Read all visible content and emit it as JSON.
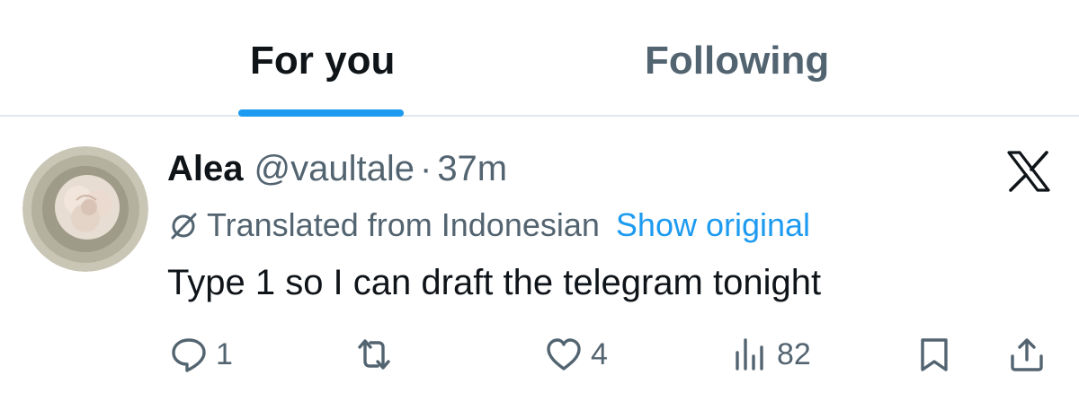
{
  "tabs": [
    {
      "label": "For you",
      "active": true
    },
    {
      "label": "Following",
      "active": false
    }
  ],
  "tweet": {
    "author_name": "Alea",
    "handle": "@vaultale",
    "separator": "·",
    "time": "37m",
    "translation_note": "Translated from Indonesian",
    "show_original_label": "Show original",
    "text": "Type 1 so I can draft the telegram tonight",
    "avatar_icon": "rose-teacup-avatar",
    "more_icon": "x-logo-icon"
  },
  "actions": {
    "reply_count": "1",
    "retweet_count": "",
    "like_count": "4",
    "views_count": "82"
  },
  "colors": {
    "accent": "#1d9bf0",
    "text_primary": "#0f1419",
    "text_secondary": "#536471",
    "divider": "#e1e8ed"
  }
}
